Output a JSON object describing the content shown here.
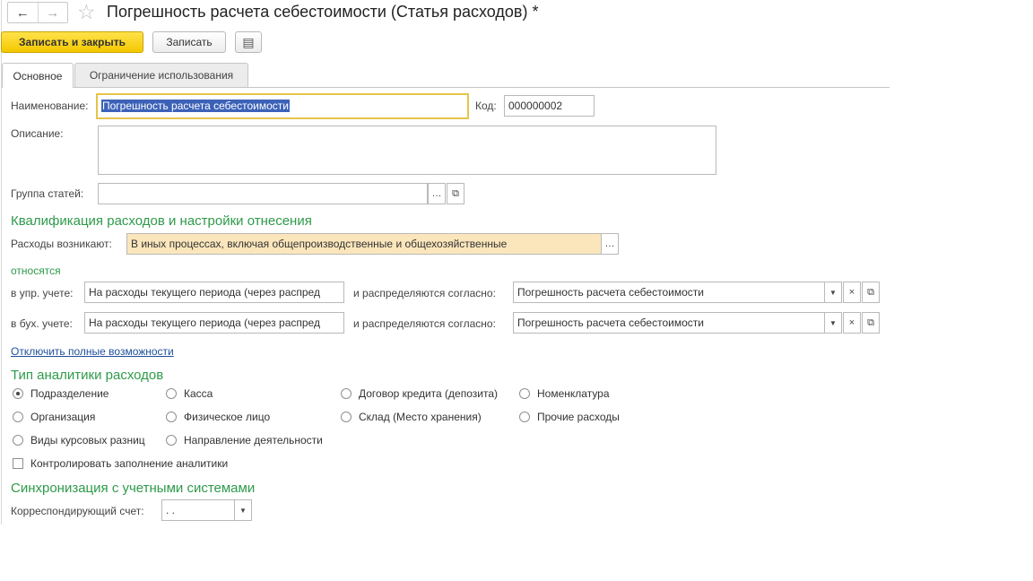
{
  "header": {
    "back_icon": "←",
    "forward_icon": "→",
    "star_icon": "☆",
    "title": "Погрешность расчета себестоимости (Статья расходов) *"
  },
  "toolbar": {
    "save_close_label": "Записать и закрыть",
    "save_label": "Записать",
    "doc_icon": "▤"
  },
  "tabs": [
    {
      "label": "Основное",
      "active": true
    },
    {
      "label": "Ограничение использования",
      "active": false
    }
  ],
  "form": {
    "name_label": "Наименование:",
    "name_value": "Погрешность расчета себестоимости",
    "code_label": "Код:",
    "code_value": "000000002",
    "description_label": "Описание:",
    "description_value": "",
    "group_label": "Группа статей:",
    "group_value": ""
  },
  "qualification": {
    "heading": "Квалификация расходов и настройки отнесения",
    "occur_label": "Расходы возникают:",
    "occur_value": "В иных процессах, включая общепроизводственные и общехозяйственные",
    "relates_label": "относятся",
    "mgmt_label": "в упр. учете:",
    "mgmt_value": "На расходы текущего периода (через распред",
    "mgmt_distr_label": "и распределяются согласно:",
    "mgmt_distr_value": "Погрешность расчета себестоимости",
    "acct_label": "в бух. учете:",
    "acct_value": "На расходы текущего периода (через распред",
    "acct_distr_label": "и распределяются согласно:",
    "acct_distr_value": "Погрешность расчета себестоимости",
    "toggle_link": "Отключить полные возможности"
  },
  "analytics": {
    "heading": "Тип аналитики расходов",
    "options": [
      {
        "label": "Подразделение",
        "checked": true
      },
      {
        "label": "Касса",
        "checked": false
      },
      {
        "label": "Договор кредита (депозита)",
        "checked": false
      },
      {
        "label": "Номенклатура",
        "checked": false
      },
      {
        "label": "Организация",
        "checked": false
      },
      {
        "label": "Физическое лицо",
        "checked": false
      },
      {
        "label": "Склад (Место хранения)",
        "checked": false
      },
      {
        "label": "Прочие расходы",
        "checked": false
      },
      {
        "label": "Виды курсовых разниц",
        "checked": false
      },
      {
        "label": "Направление деятельности",
        "checked": false
      }
    ],
    "control_label": "Контролировать заполнение аналитики"
  },
  "sync": {
    "heading": "Синхронизация с учетными системами",
    "account_label": "Корреспондирующий счет:",
    "account_value": ". ."
  },
  "colors": {
    "accent_green": "#2e9a4a",
    "primary_button": "#f4c800",
    "highlight_field": "#fbe6bc",
    "selection": "#3c62b8",
    "link": "#1f4f9a"
  }
}
